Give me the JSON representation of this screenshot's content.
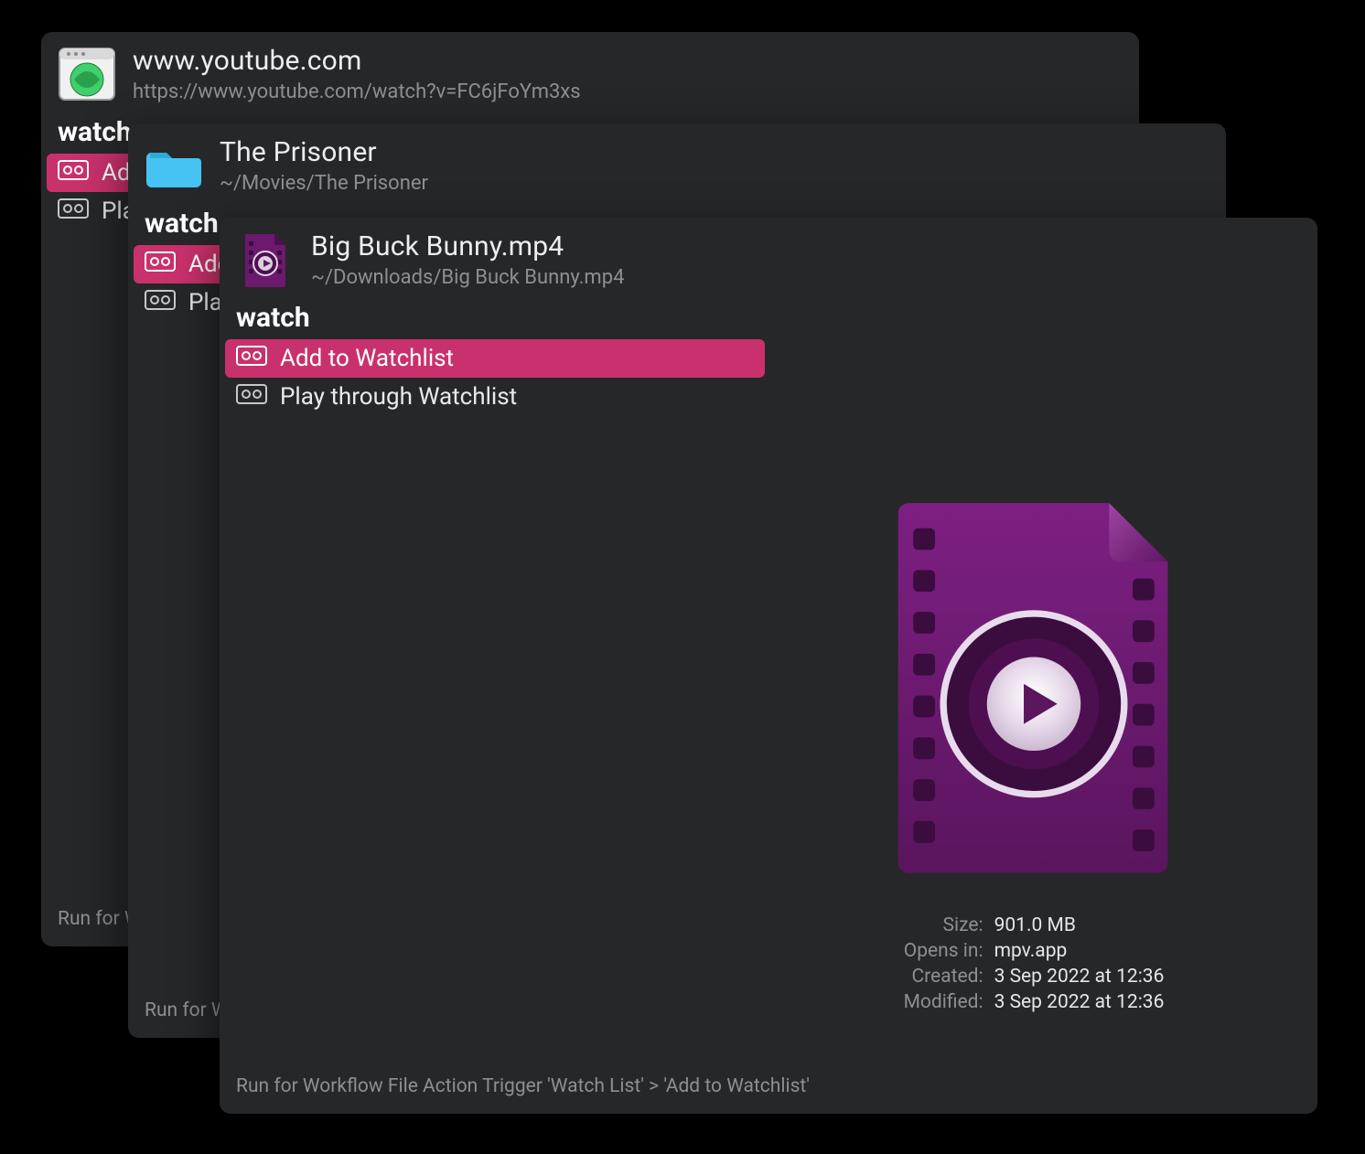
{
  "windows": [
    {
      "title": "www.youtube.com",
      "subtitle": "https://www.youtube.com/watch?v=FC6jFoYm3xs",
      "query": "watch",
      "rows": [
        {
          "label": "Add to Watchlist",
          "selected": true
        },
        {
          "label": "Play through Watchlist",
          "selected": false
        }
      ],
      "footer": "Run for Workflow File Action Trigger 'Watch List' > 'Add to Watchlist'"
    },
    {
      "title": "The Prisoner",
      "subtitle": "~/Movies/The Prisoner",
      "query": "watch",
      "rows": [
        {
          "label": "Add to Watchlist",
          "selected": true
        },
        {
          "label": "Play through Watchlist",
          "selected": false
        }
      ],
      "footer": "Run for Workflow File Action Trigger 'Watch List' > 'Add to Watchlist'"
    },
    {
      "title": "Big Buck Bunny.mp4",
      "subtitle": "~/Downloads/Big Buck Bunny.mp4",
      "query": "watch",
      "rows": [
        {
          "label": "Add to Watchlist",
          "selected": true
        },
        {
          "label": "Play through Watchlist",
          "selected": false
        }
      ],
      "footer": "Run for Workflow File Action Trigger 'Watch List' > 'Add to Watchlist'",
      "preview_meta": {
        "size_label": "Size:",
        "size_value": "901.0 MB",
        "opens_label": "Opens in:",
        "opens_value": "mpv.app",
        "created_label": "Created:",
        "created_value": "3 Sep 2022 at 12:36",
        "modified_label": "Modified:",
        "modified_value": "3 Sep 2022 at 12:36"
      }
    }
  ]
}
